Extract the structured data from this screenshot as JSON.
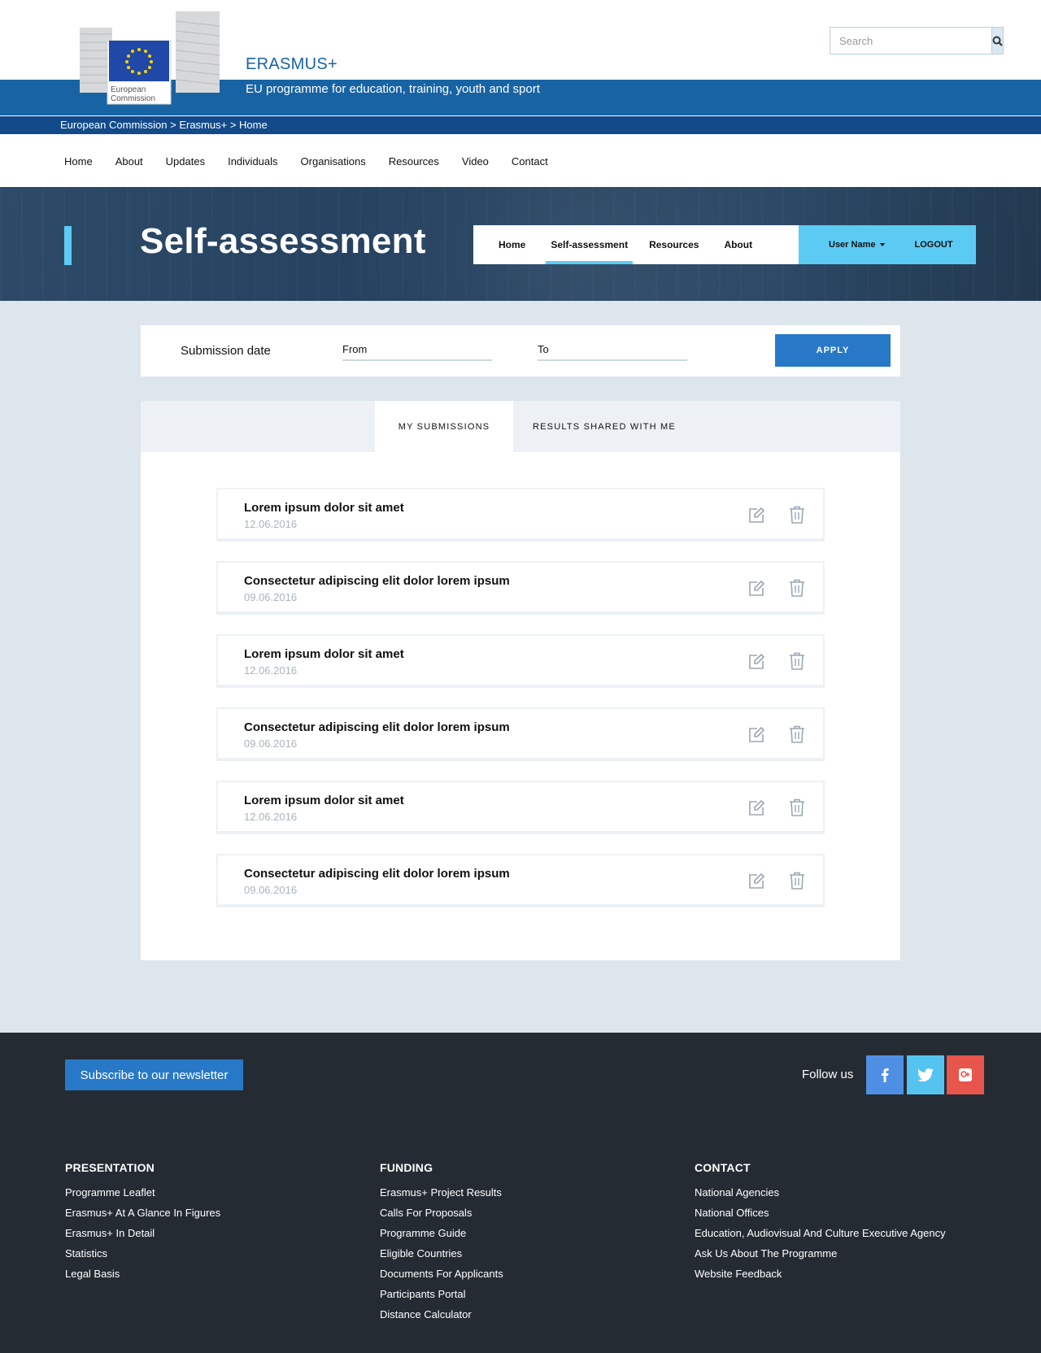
{
  "header": {
    "logo_text_line1": "European",
    "logo_text_line2": "Commission",
    "site_name": "ERASMUS+",
    "tagline": "EU programme for education, training, youth and sport",
    "search_placeholder": "Search",
    "breadcrumb": "European Commission > Erasmus+ > Home"
  },
  "main_nav": [
    "Home",
    "About",
    "Updates",
    "Individuals",
    "Organisations",
    "Resources",
    "Video",
    "Contact"
  ],
  "hero": {
    "title": "Self-assessment",
    "sub_nav": {
      "home": "Home",
      "self_assessment": "Self-assessment",
      "resources": "Resources",
      "about": "About"
    },
    "user_name": "User Name",
    "logout": "LOGOUT"
  },
  "filter": {
    "label": "Submission date",
    "from_placeholder": "From",
    "to_placeholder": "To",
    "apply": "APPLY"
  },
  "tabs": {
    "mine": "MY SUBMISSIONS",
    "shared": "RESULTS SHARED WITH ME"
  },
  "submissions": [
    {
      "title": "Lorem ipsum dolor sit amet",
      "date": "12.06.2016"
    },
    {
      "title": "Consectetur adipiscing elit dolor lorem ipsum",
      "date": "09.06.2016"
    },
    {
      "title": "Lorem ipsum dolor sit amet",
      "date": "12.06.2016"
    },
    {
      "title": "Consectetur adipiscing elit dolor lorem ipsum",
      "date": "09.06.2016"
    },
    {
      "title": "Lorem ipsum dolor sit amet",
      "date": "12.06.2016"
    },
    {
      "title": "Consectetur adipiscing elit dolor lorem ipsum",
      "date": "09.06.2016"
    }
  ],
  "footer": {
    "newsletter": "Subscribe to our newsletter",
    "follow": "Follow us",
    "columns": [
      {
        "heading": "PRESENTATION",
        "links": [
          "Programme Leaflet",
          "Erasmus+ At A Glance In Figures",
          "Erasmus+ In Detail",
          "Statistics",
          "Legal Basis"
        ]
      },
      {
        "heading": "FUNDING",
        "links": [
          "Erasmus+ Project Results",
          "Calls For Proposals",
          "Programme Guide",
          "Eligible Countries",
          "Documents For Applicants",
          "Participants Portal",
          "Distance Calculator"
        ]
      },
      {
        "heading": "CONTACT",
        "links": [
          "National Agencies",
          "National Offices",
          "Education, Audiovisual And Culture Executive Agency",
          "Ask Us About The Programme",
          "Website Feedback"
        ]
      }
    ]
  },
  "colors": {
    "brand_blue": "#1863a4",
    "accent_cyan": "#5ccbf3",
    "button_blue": "#2878c8",
    "footer_bg": "#252b33",
    "content_bg": "#dde5ed"
  },
  "icons": [
    "search-icon",
    "edit-icon",
    "trash-icon",
    "facebook-icon",
    "twitter-icon",
    "google-plus-icon"
  ]
}
